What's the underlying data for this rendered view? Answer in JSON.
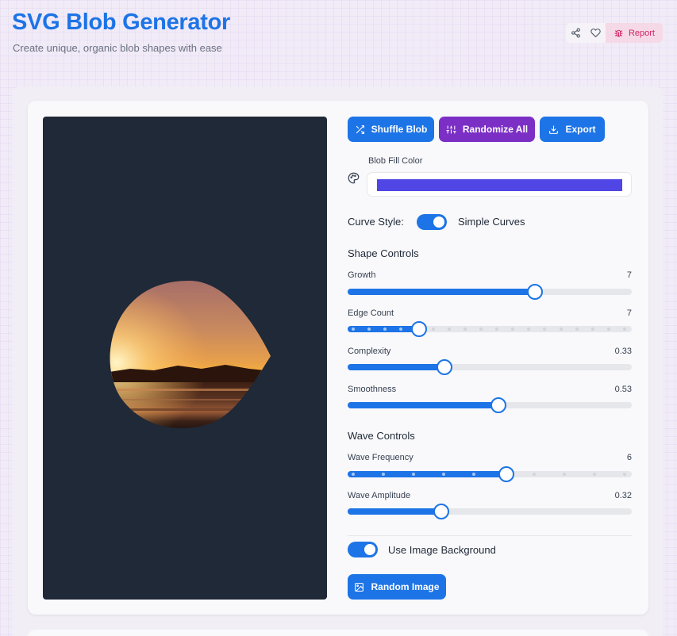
{
  "header": {
    "title": "SVG Blob Generator",
    "subtitle": "Create unique, organic blob shapes with ease",
    "actions": {
      "share_icon": "share-icon",
      "favorite_icon": "heart-icon",
      "report_label": "Report",
      "report_icon": "bug-icon"
    }
  },
  "toolbar": {
    "shuffle_label": "Shuffle Blob",
    "randomize_label": "Randomize All",
    "export_label": "Export"
  },
  "fill": {
    "label": "Blob Fill Color",
    "color": "#4f46e5",
    "icon": "palette-icon"
  },
  "curve": {
    "label": "Curve Style:",
    "value_label": "Simple Curves",
    "enabled": true
  },
  "shape_controls": {
    "heading": "Shape Controls",
    "growth": {
      "label": "Growth",
      "value": "7",
      "fraction": 0.66
    },
    "edge_count": {
      "label": "Edge Count",
      "value": "7",
      "fraction": 0.25
    },
    "complexity": {
      "label": "Complexity",
      "value": "0.33",
      "fraction": 0.34
    },
    "smoothness": {
      "label": "Smoothness",
      "value": "0.53",
      "fraction": 0.53
    }
  },
  "wave_controls": {
    "heading": "Wave Controls",
    "frequency": {
      "label": "Wave Frequency",
      "value": "6",
      "fraction": 0.56
    },
    "amplitude": {
      "label": "Wave Amplitude",
      "value": "0.32",
      "fraction": 0.33
    }
  },
  "image_bg": {
    "label": "Use Image Background",
    "enabled": true,
    "random_button_label": "Random Image"
  },
  "colors": {
    "accent": "#1d74e6",
    "purple": "#7b2fc5",
    "preview_bg": "#1f2937"
  }
}
